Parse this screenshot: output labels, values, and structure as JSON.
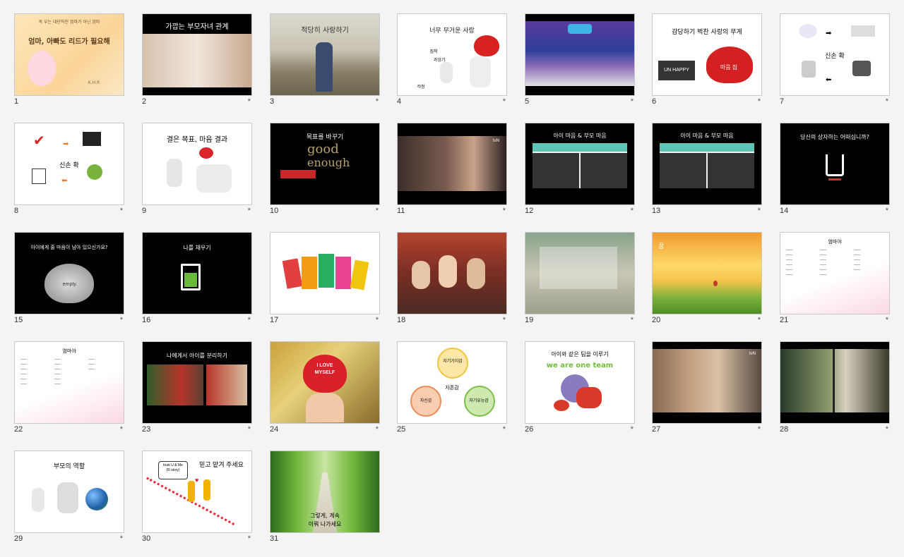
{
  "slides": [
    {
      "num": "1",
      "star": "",
      "lines": [
        "꼭 우는 대단하진 엄마가 아닌 엄마",
        "엄마, 아빠도 리드가 필요해",
        "K.H.R"
      ]
    },
    {
      "num": "2",
      "star": "*",
      "lines": [
        "가깝는 부모자녀 관계"
      ]
    },
    {
      "num": "3",
      "star": "*",
      "lines": [
        "적당히 사랑하기"
      ]
    },
    {
      "num": "4",
      "star": "*",
      "lines": [
        "너무 무거운 사랑",
        "집착",
        "과잉기",
        "걱정"
      ]
    },
    {
      "num": "5",
      "star": "*",
      "lines": []
    },
    {
      "num": "6",
      "star": "*",
      "lines": [
        "감당하기 벅찬 사랑의 무게",
        "UN HAPPY",
        "마음 짐"
      ]
    },
    {
      "num": "7",
      "star": "*",
      "lines": [
        "신손 확"
      ]
    },
    {
      "num": "8",
      "star": "*",
      "lines": [
        "신손 확"
      ]
    },
    {
      "num": "9",
      "star": "*",
      "lines": [
        "결은 목표, 마음 결과"
      ]
    },
    {
      "num": "10",
      "star": "*",
      "lines": [
        "목표를 바꾸기",
        "good",
        "enough"
      ]
    },
    {
      "num": "11",
      "star": "*",
      "lines": [
        "tvN"
      ]
    },
    {
      "num": "12",
      "star": "*",
      "lines": [
        "아이 마음 & 부모 마음"
      ]
    },
    {
      "num": "13",
      "star": "*",
      "lines": [
        "아이 마음 & 부모 마음"
      ]
    },
    {
      "num": "14",
      "star": "*",
      "lines": [
        "당신의 상자하는 어떠십니까?"
      ]
    },
    {
      "num": "15",
      "star": "*",
      "lines": [
        "아이에게 줄 마음이 남아 있으신가요?",
        "empty."
      ]
    },
    {
      "num": "16",
      "star": "*",
      "lines": [
        "나를 채우기"
      ]
    },
    {
      "num": "17",
      "star": "*",
      "lines": []
    },
    {
      "num": "18",
      "star": "*",
      "lines": []
    },
    {
      "num": "19",
      "star": "*",
      "lines": []
    },
    {
      "num": "20",
      "star": "*",
      "lines": [
        "꿈"
      ]
    },
    {
      "num": "21",
      "star": "*",
      "lines": [
        "엄마야"
      ]
    },
    {
      "num": "22",
      "star": "*",
      "lines": [
        "엄마야"
      ]
    },
    {
      "num": "23",
      "star": "*",
      "lines": [
        "나에게서 아이를 분리하기"
      ]
    },
    {
      "num": "24",
      "star": "*",
      "lines": [
        "I LOVE",
        "MYSELF"
      ]
    },
    {
      "num": "25",
      "star": "*",
      "lines": [
        "자기가치감",
        "자존감",
        "자신감",
        "자기유능감"
      ]
    },
    {
      "num": "26",
      "star": "*",
      "lines": [
        "아이와 같은 팀을 이루기",
        "we are one team"
      ]
    },
    {
      "num": "27",
      "star": "*",
      "lines": [
        "tvN"
      ]
    },
    {
      "num": "28",
      "star": "*",
      "lines": []
    },
    {
      "num": "29",
      "star": "*",
      "lines": [
        "부모의 역할"
      ]
    },
    {
      "num": "30",
      "star": "*",
      "lines": [
        "믿고 맡겨 주세요",
        "trust U & Me",
        "(R story)"
      ]
    },
    {
      "num": "31",
      "star": "",
      "lines": [
        "그렇게, 계속",
        "이뤄 나가세요"
      ]
    }
  ]
}
